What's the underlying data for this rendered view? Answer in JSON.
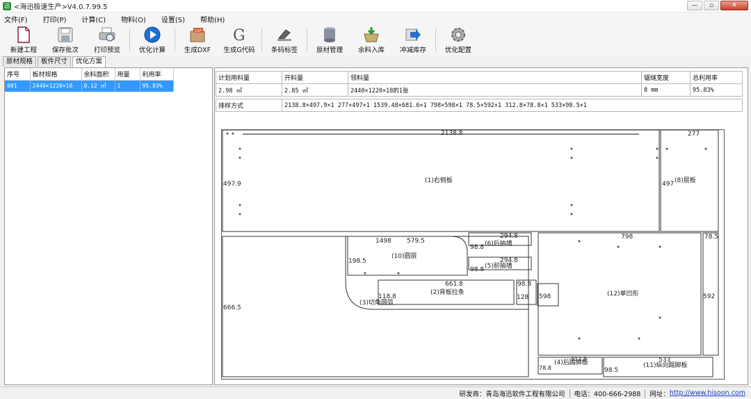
{
  "window": {
    "title": "<海迅极速生产>V4.0.7.99.5",
    "minimize": "0",
    "restore": "1",
    "close": "r"
  },
  "menu": [
    "文件(F)",
    "打印(P)",
    "计算(C)",
    "物料(O)",
    "设置(S)",
    "帮助(H)"
  ],
  "toolbar": [
    {
      "label": "新建工程",
      "icon": "new-project-icon"
    },
    {
      "label": "保存批次",
      "icon": "save-icon"
    },
    {
      "label": "打印预览",
      "icon": "print-preview-icon"
    },
    {
      "label": "优化计算",
      "icon": "play-icon"
    },
    {
      "label": "生成DXF",
      "icon": "dxf-icon"
    },
    {
      "label": "生成G代码",
      "icon": "g-code-icon"
    },
    {
      "label": "条码标签",
      "icon": "barcode-scanner-icon"
    },
    {
      "label": "原材管理",
      "icon": "material-cylinder-icon"
    },
    {
      "label": "余料入库",
      "icon": "basket-icon"
    },
    {
      "label": "冲减库存",
      "icon": "arrow-icon"
    },
    {
      "label": "优化配置",
      "icon": "gear-icon"
    }
  ],
  "tabs": [
    "原材规格",
    "板件尺寸",
    "优化方案"
  ],
  "left_table": {
    "headers": [
      "序号",
      "板材规格",
      "余料面积",
      "用量",
      "利用率"
    ],
    "rows": [
      [
        "001",
        "2440×1220×18",
        "0.12 ㎡",
        "1",
        "95.83%"
      ]
    ]
  },
  "info": {
    "headers": [
      "计划用料量",
      "开料量",
      "领料量",
      "锯缝宽度",
      "总利用率"
    ],
    "values": [
      "2.98 ㎡",
      "2.85 ㎡",
      "2440×1220×18的1张",
      "8 mm",
      "95.83%"
    ],
    "sort_label": "排样方式",
    "sort_value": "2138.8×497.9×1 277×497×1 1539.48×681.6×1 798×598×1 78.5×592×1 312.8×78.8×1 533×98.5×1"
  },
  "parts": {
    "p1": {
      "name": "(1)右侧板",
      "w": "2138.8",
      "h": "497.9"
    },
    "p8": {
      "name": "(8)层板",
      "w": "277",
      "h": "497"
    },
    "p10": {
      "name": "(10)圆层",
      "w1": "1498",
      "w2": "579.5",
      "h": "198.5"
    },
    "p6": {
      "name": "(6)后抽墙",
      "w": "294.8",
      "h": "98.8"
    },
    "p5": {
      "name": "(5)前抽墙",
      "w": "294.8",
      "h": "98.8"
    },
    "p2": {
      "name": "(2)背板拉条",
      "w": "661.8",
      "h": "118.8"
    },
    "p3": {
      "name": "(3)切角圆弧",
      "h": "666.5"
    },
    "p7": {
      "name": "(7)抽屉",
      "w": "98.8",
      "h": "128"
    },
    "small": {
      "v": "598"
    },
    "p12": {
      "name": "(12)单凹形",
      "w": "798"
    },
    "p9": {
      "name": "(9)前抽墙",
      "w": "78.5",
      "h": "592"
    },
    "p4": {
      "name": "(4)后踢脚板",
      "w": "312.8",
      "h": "78.8"
    },
    "p11": {
      "name": "(11)纵向踢脚板",
      "w": "533",
      "h": "98.5"
    }
  },
  "status": {
    "developer": "研发商：青岛海迅软件工程有限公司",
    "phone": "电话：400-666-2988",
    "site_label": "网址：",
    "site_url": "http://www.hisoon.com"
  },
  "colors": {
    "selection": "#3399ff",
    "play_icon": "#1e6fd9",
    "close_button": "#c8402c"
  }
}
